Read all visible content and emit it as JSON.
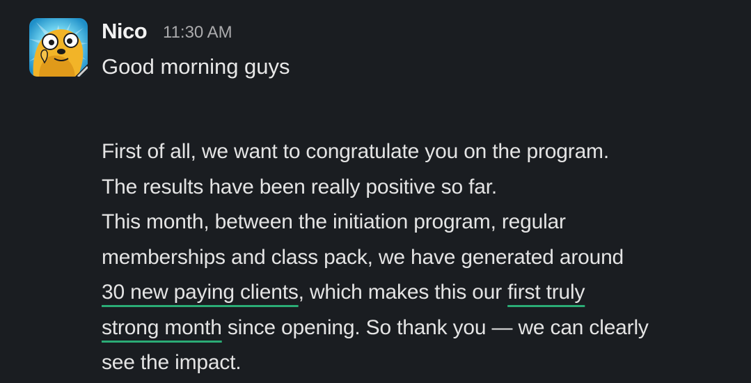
{
  "message": {
    "sender": "Nico",
    "timestamp": "11:30 AM",
    "avatar_icon": "cartoon-dog-avatar",
    "greeting": "Good morning guys",
    "body": {
      "l1": "First of all, we want to congratulate you on the program.",
      "l2": "The results have been really positive so far.",
      "l3": "This month, between the initiation program, regular",
      "l4": "memberships and class pack, we have generated around",
      "l5_hl": "30 new paying clients",
      "l5_rest": ", which makes this our ",
      "l5_hl2": "first truly",
      "l6_hl": "strong month",
      "l6_rest": " since opening. So thank you — we can clearly",
      "l7": "see the impact."
    }
  },
  "colors": {
    "background": "#1a1d21",
    "underline": "#2bac76",
    "text": "#e4e4e4",
    "timestamp": "#ababad"
  }
}
